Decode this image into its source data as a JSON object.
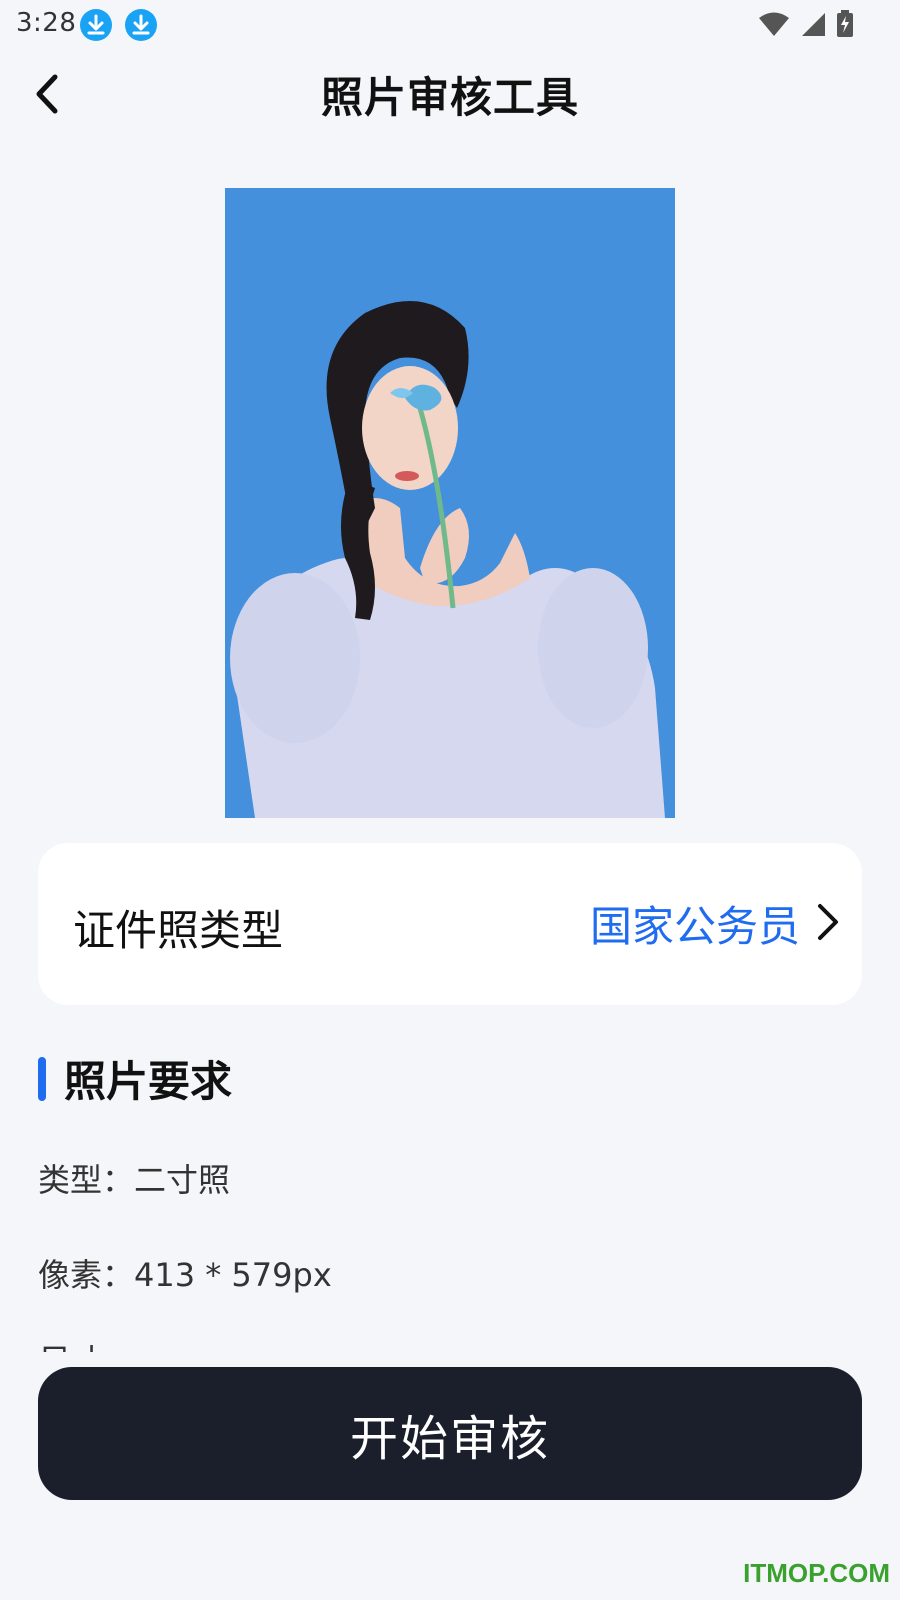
{
  "status_bar": {
    "time": "3:28",
    "icons": [
      "download-icon",
      "download-icon",
      "wifi-icon",
      "signal-icon",
      "battery-charging-icon"
    ]
  },
  "header": {
    "title": "照片审核工具",
    "back_icon": "chevron-left-icon"
  },
  "photo": {
    "background_color": "#4490dc",
    "description_icon": "portrait-photo"
  },
  "id_type_card": {
    "label": "证件照类型",
    "value": "国家公务员",
    "chevron_icon": "chevron-right-icon"
  },
  "requirements": {
    "title": "照片要求",
    "items": [
      {
        "text": "类型：二寸照"
      },
      {
        "text": "像素：413 * 579px"
      }
    ],
    "partial_item": "尺寸"
  },
  "start_button": {
    "label": "开始审核"
  },
  "watermark": {
    "text": "ITMOP.COM"
  },
  "colors": {
    "accent": "#1f6cf1",
    "button_bg": "#1b1f2b",
    "page_bg": "#f5f6fa",
    "photo_bg": "#4490dc",
    "watermark": "#3aa02e"
  }
}
